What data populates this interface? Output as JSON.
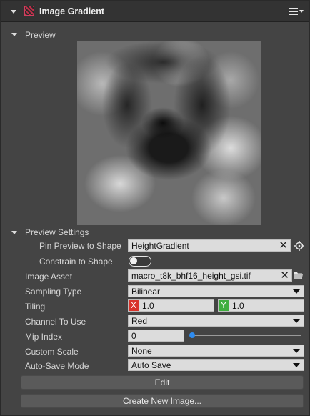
{
  "header": {
    "title": "Image Gradient",
    "component_icon": "image-gradient-icon",
    "menu_icon": "hamburger-menu-icon"
  },
  "preview_section": {
    "label": "Preview"
  },
  "settings_section": {
    "label": "Preview Settings",
    "pin_preview": {
      "label": "Pin Preview to Shape",
      "value": "HeightGradient"
    },
    "constrain": {
      "label": "Constrain to Shape",
      "checked": false
    }
  },
  "properties": {
    "image_asset": {
      "label": "Image Asset",
      "value": "macro_t8k_bhf16_height_gsi.tif"
    },
    "sampling_type": {
      "label": "Sampling Type",
      "value": "Bilinear"
    },
    "tiling": {
      "label": "Tiling",
      "x_tag": "X",
      "x_value": "1.0",
      "y_tag": "Y",
      "y_value": "1.0"
    },
    "channel": {
      "label": "Channel To Use",
      "value": "Red"
    },
    "mip_index": {
      "label": "Mip Index",
      "value": "0",
      "slider_fraction": 0
    },
    "custom_scale": {
      "label": "Custom Scale",
      "value": "None"
    },
    "auto_save": {
      "label": "Auto-Save Mode",
      "value": "Auto Save"
    }
  },
  "buttons": {
    "edit": "Edit",
    "create": "Create New Image..."
  },
  "colors": {
    "x_tag": "#d9342b",
    "y_tag": "#3fae3f",
    "slider_accent": "#2e8cf0"
  }
}
